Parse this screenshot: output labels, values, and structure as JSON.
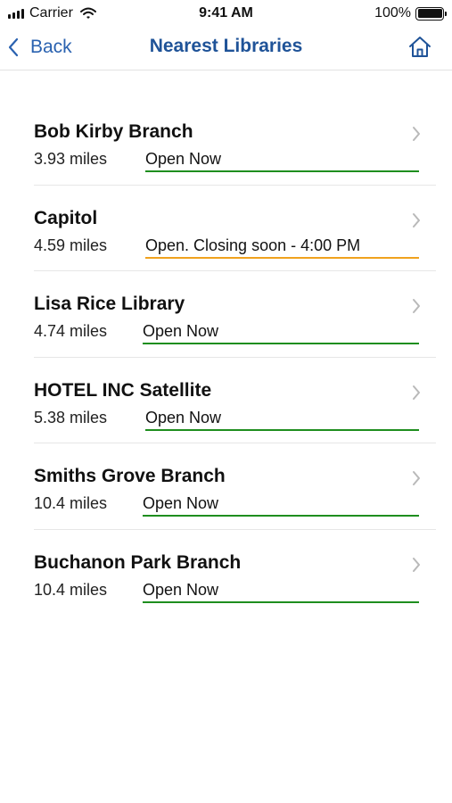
{
  "status_bar": {
    "carrier": "Carrier",
    "time": "9:41 AM",
    "battery": "100%"
  },
  "nav": {
    "back_label": "Back",
    "title": "Nearest Libraries"
  },
  "colors": {
    "accent": "#1f5398",
    "open": "#1e8e1e",
    "closing": "#f0a21e"
  },
  "libraries": [
    {
      "name": "Bob Kirby Branch",
      "distance": "3.93 miles",
      "status": "Open Now"
    },
    {
      "name": "Capitol",
      "distance": "4.59 miles",
      "status": "Open. Closing soon - 4:00 PM"
    },
    {
      "name": "Lisa Rice Library",
      "distance": "4.74 miles",
      "status": "Open Now"
    },
    {
      "name": "HOTEL INC Satellite",
      "distance": "5.38 miles",
      "status": "Open Now"
    },
    {
      "name": "Smiths Grove Branch",
      "distance": "10.4 miles",
      "status": "Open Now"
    },
    {
      "name": "Buchanon Park Branch",
      "distance": "10.4 miles",
      "status": "Open Now"
    }
  ]
}
